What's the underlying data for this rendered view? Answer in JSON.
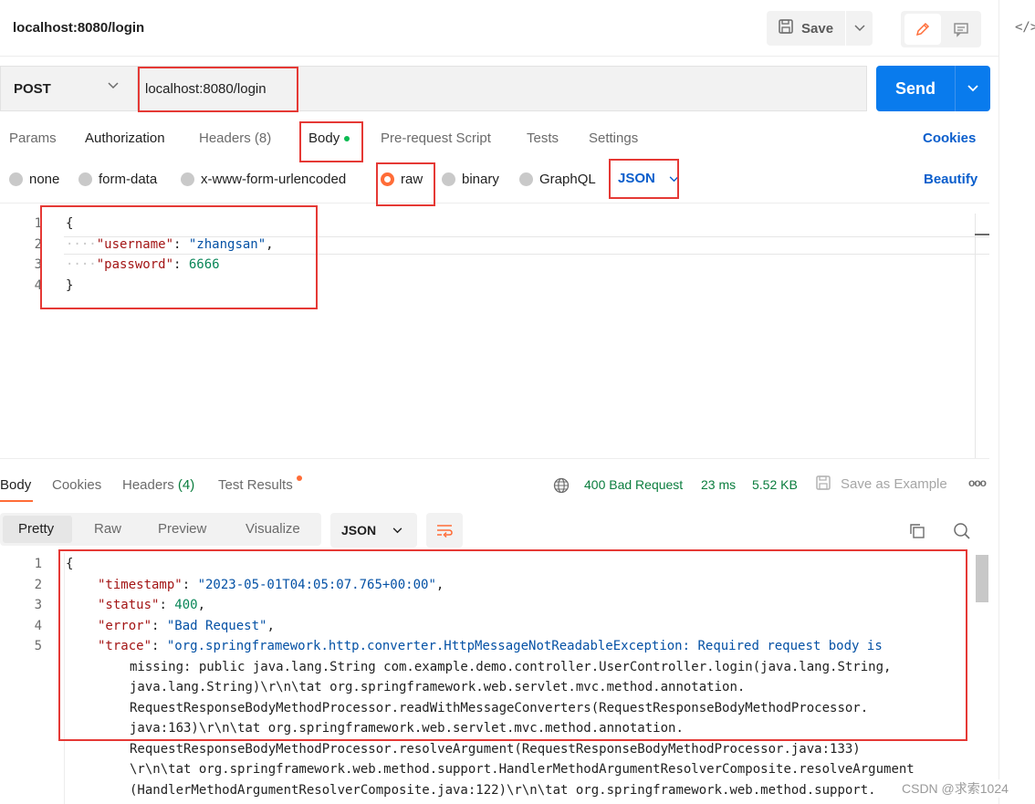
{
  "header": {
    "tab_title": "localhost:8080/login",
    "save_label": "Save"
  },
  "request": {
    "method": "POST",
    "url": "localhost:8080/login",
    "send_label": "Send"
  },
  "request_tabs": {
    "params": "Params",
    "authorization": "Authorization",
    "headers": "Headers",
    "headers_count": "(8)",
    "body": "Body",
    "pre_request": "Pre-request Script",
    "tests": "Tests",
    "settings": "Settings",
    "cookies": "Cookies"
  },
  "body_types": {
    "none": "none",
    "form_data": "form-data",
    "urlencoded": "x-www-form-urlencoded",
    "raw": "raw",
    "binary": "binary",
    "graphql": "GraphQL",
    "language": "JSON",
    "beautify": "Beautify",
    "selected": "raw"
  },
  "request_body": {
    "line_numbers": [
      "1",
      "2",
      "3",
      "4"
    ],
    "open_brace": "{",
    "close_brace": "}",
    "indent": "····",
    "username_key": "\"username\"",
    "username_value": "\"zhangsan\"",
    "password_key": "\"password\"",
    "password_value": "6666",
    "colon": ": ",
    "comma": ","
  },
  "response_tabs": {
    "body": "Body",
    "cookies": "Cookies",
    "headers": "Headers",
    "headers_count": "(4)",
    "test_results": "Test Results"
  },
  "response_status": {
    "status": "400 Bad Request",
    "time": "23 ms",
    "size": "5.52 KB",
    "save_example": "Save as Example",
    "more": "ooo"
  },
  "response_formats": {
    "pretty": "Pretty",
    "raw": "Raw",
    "preview": "Preview",
    "visualize": "Visualize",
    "language": "JSON"
  },
  "response_body": {
    "line_numbers": [
      "1",
      "2",
      "3",
      "4",
      "5"
    ],
    "open_brace": "{",
    "timestamp_key": "\"timestamp\"",
    "timestamp_value": "\"2023-05-01T04:05:07.765+00:00\"",
    "status_key": "\"status\"",
    "status_value": "400",
    "error_key": "\"error\"",
    "error_value": "\"Bad Request\"",
    "trace_key": "\"trace\"",
    "trace_lines": [
      "\"org.springframework.http.converter.HttpMessageNotReadableException: Required request body is",
      "missing: public java.lang.String com.example.demo.controller.UserController.login(java.lang.String,",
      "java.lang.String)\\r\\n\\tat org.springframework.web.servlet.mvc.method.annotation.",
      "RequestResponseBodyMethodProcessor.readWithMessageConverters(RequestResponseBodyMethodProcessor.",
      "java:163)\\r\\n\\tat org.springframework.web.servlet.mvc.method.annotation.",
      "RequestResponseBodyMethodProcessor.resolveArgument(RequestResponseBodyMethodProcessor.java:133)",
      "\\r\\n\\tat org.springframework.web.method.support.HandlerMethodArgumentResolverComposite.resolveArgument",
      "(HandlerMethodArgumentResolverComposite.java:122)\\r\\n\\tat org.springframework.web.method.support."
    ]
  },
  "watermark": "CSDN @求索1024",
  "colors": {
    "send": "#097bed",
    "accent": "#ff6c37",
    "highlight_box": "#e53935",
    "status_ok_text": "#0a7d3e",
    "link": "#0b5ecc"
  }
}
